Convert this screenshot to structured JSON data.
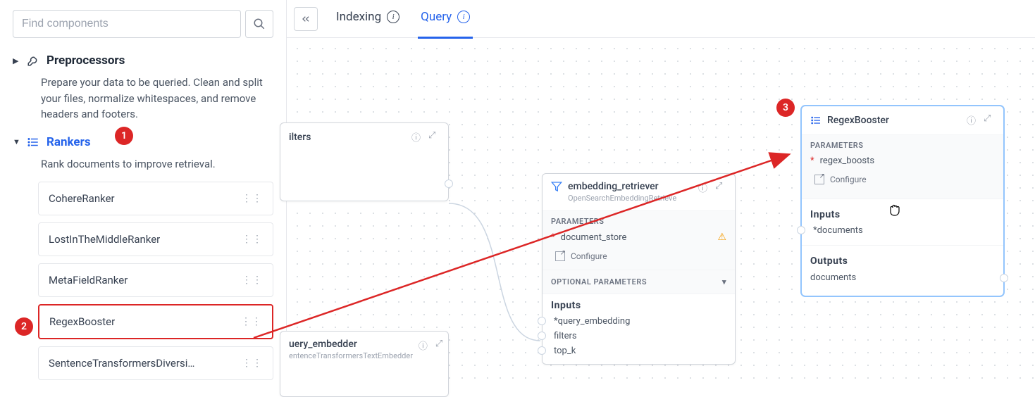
{
  "sidebar": {
    "search_placeholder": "Find components",
    "preprocessors": {
      "title": "Preprocessors",
      "desc": "Prepare your data to be queried. Clean and split your files, normalize whitespaces, and remove headers and footers."
    },
    "rankers": {
      "title": "Rankers",
      "desc": "Rank documents to improve retrieval.",
      "items": [
        "CohereRanker",
        "LostInTheMiddleRanker",
        "MetaFieldRanker",
        "RegexBooster",
        "SentenceTransformersDiversi…"
      ]
    }
  },
  "tabs": {
    "indexing": "Indexing",
    "query": "Query"
  },
  "nodes": {
    "filters": {
      "title": "ilters"
    },
    "query_embedder": {
      "title": "uery_embedder",
      "subtitle": "entenceTransformersTextEmbedder"
    },
    "embedding_retriever": {
      "title": "embedding_retriever",
      "subtitle": "OpenSearchEmbeddingRetrieve",
      "parameters_label": "PARAMETERS",
      "document_store": "document_store",
      "configure": "Configure",
      "optional_label": "OPTIONAL PARAMETERS",
      "inputs_label": "Inputs",
      "inputs": [
        "query_embedding",
        "filters",
        "top_k"
      ]
    },
    "regex_booster": {
      "title": "RegexBooster",
      "parameters_label": "PARAMETERS",
      "regex_boosts": "regex_boosts",
      "configure": "Configure",
      "inputs_label": "Inputs",
      "input_documents": "documents",
      "outputs_label": "Outputs",
      "output_documents": "documents"
    }
  },
  "annotations": {
    "b1": "1",
    "b2": "2",
    "b3": "3"
  }
}
